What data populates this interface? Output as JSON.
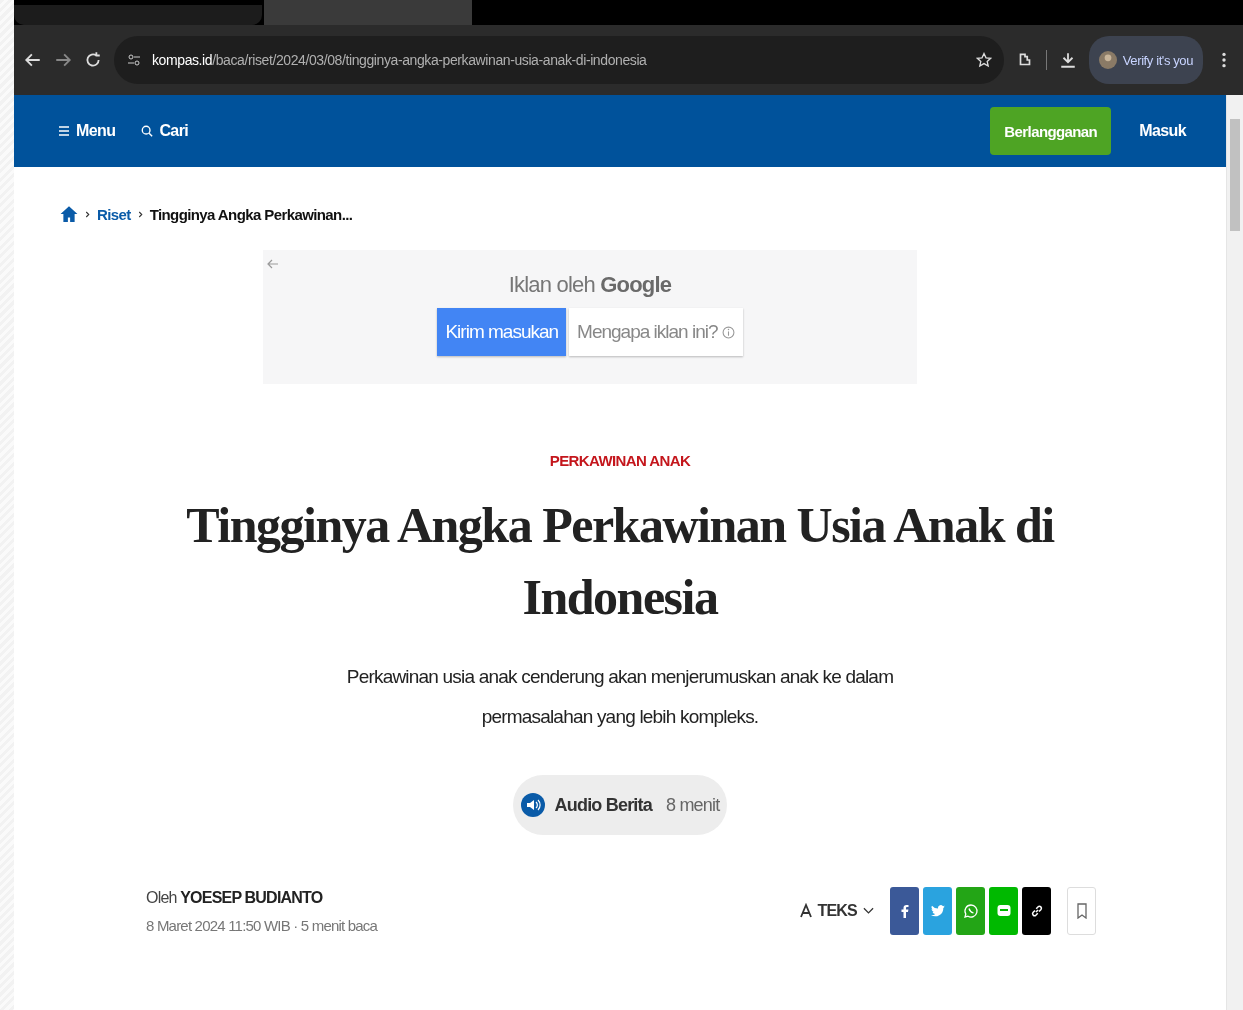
{
  "browser": {
    "url_host": "kompas.id",
    "url_path": "/baca/riset/2024/03/08/tingginya-angka-perkawinan-usia-anak-di-indonesia",
    "profile_label": "Verify it's you"
  },
  "site_nav": {
    "menu": "Menu",
    "search": "Cari",
    "subscribe": "Berlangganan",
    "login": "Masuk"
  },
  "breadcrumb": [
    "Riset",
    "Tingginya Angka Perkawinan..."
  ],
  "ad": {
    "label": "Iklan oleh",
    "brand": "Google",
    "feedback_button": "Kirim masukan",
    "why_button": "Mengapa iklan ini?"
  },
  "article": {
    "category": "PERKAWINAN ANAK",
    "title": "Tingginya Angka Perkawinan Usia Anak di Indonesia",
    "summary": "Perkawinan usia anak cenderung akan menjerumuskan anak ke dalam permasalahan yang lebih kompleks.",
    "audio": {
      "label": "Audio Berita",
      "duration": "8 menit"
    },
    "byline_prefix": "Oleh",
    "author": "YOESEP BUDIANTO",
    "meta": "8 Maret 2024 11:50 WIB · 5 menit baca",
    "text_size": "TEKS"
  },
  "share": [
    {
      "kind": "facebook",
      "color": "#3b5998"
    },
    {
      "kind": "twitter",
      "color": "#2aa3df"
    },
    {
      "kind": "whatsapp",
      "color": "#23a516"
    },
    {
      "kind": "line",
      "color": "#00b900"
    },
    {
      "kind": "link",
      "color": "#000000"
    }
  ]
}
